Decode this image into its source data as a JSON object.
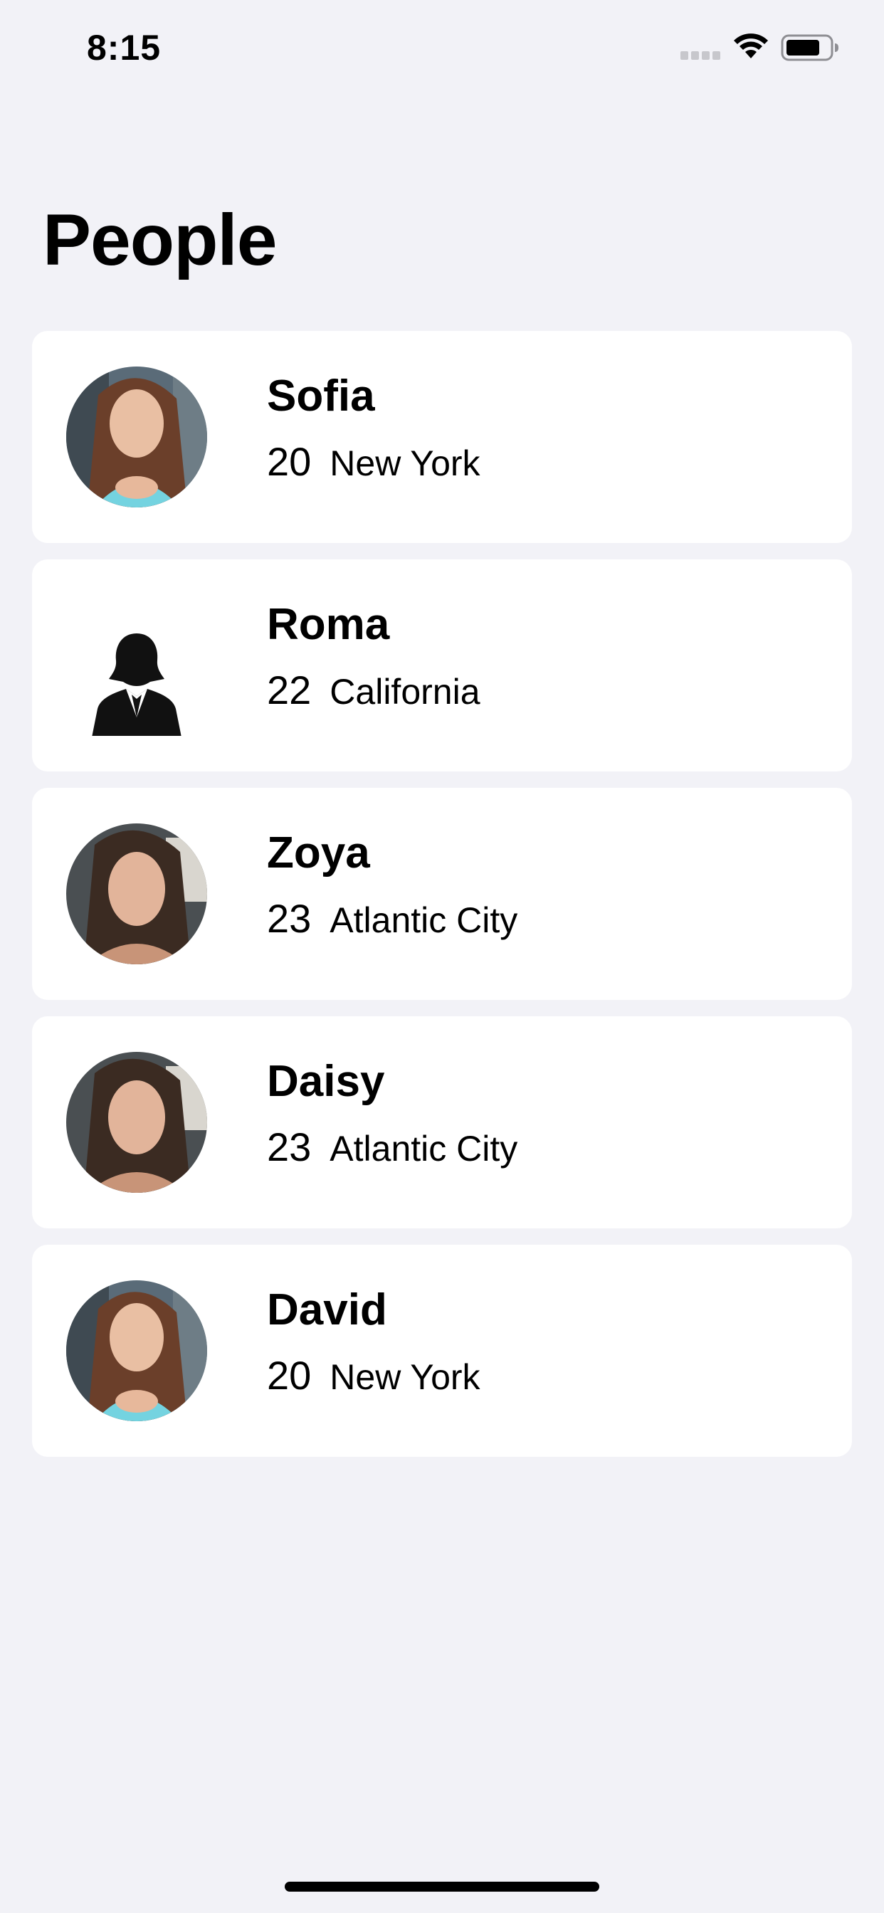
{
  "status_bar": {
    "time": "8:15",
    "icons": [
      "cellular-signal-icon",
      "wifi-icon",
      "battery-icon"
    ]
  },
  "title": "People",
  "people": [
    {
      "name": "Sofia",
      "age": "20",
      "city": "New York",
      "avatar": "photo-smiling-woman-blue-top"
    },
    {
      "name": "Roma",
      "age": "22",
      "city": "California",
      "avatar": "female-silhouette-placeholder-icon"
    },
    {
      "name": "Zoya",
      "age": "23",
      "city": "Atlantic City",
      "avatar": "photo-woman-selfie"
    },
    {
      "name": "Daisy",
      "age": "23",
      "city": "Atlantic City",
      "avatar": "photo-woman-selfie"
    },
    {
      "name": "David",
      "age": "20",
      "city": "New York",
      "avatar": "photo-smiling-woman-blue-top"
    }
  ],
  "colors": {
    "background": "#f2f2f7",
    "card": "#ffffff",
    "text": "#000000"
  }
}
